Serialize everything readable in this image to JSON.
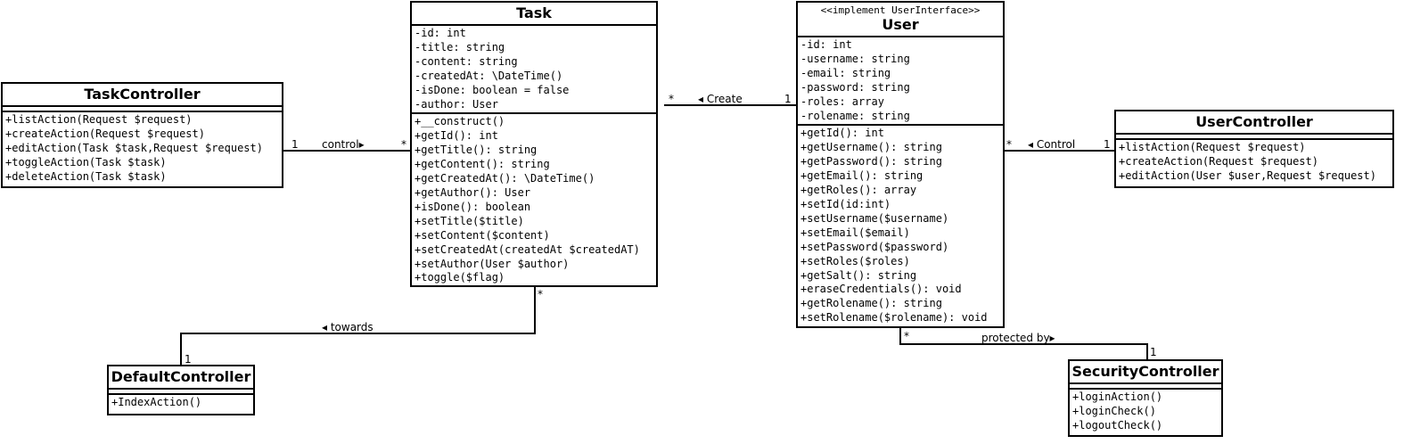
{
  "classes": {
    "task": {
      "name": "Task",
      "attributes": [
        "-id: int",
        "-title: string",
        "-content: string",
        "-createdAt: \\DateTime()",
        "-isDone: boolean = false",
        "-author: User"
      ],
      "methods": [
        "+__construct()",
        "+getId(): int",
        "+getTitle(): string",
        "+getContent(): string",
        "+getCreatedAt(): \\DateTime()",
        "+getAuthor(): User",
        "+isDone(): boolean",
        "+setTitle($title)",
        "+setContent($content)",
        "+setCreatedAt(createdAt $createdAT)",
        "+setAuthor(User $author)",
        "+toggle($flag)"
      ]
    },
    "task_controller": {
      "name": "TaskController",
      "methods": [
        "+listAction(Request $request)",
        "+createAction(Request $request)",
        "+editAction(Task $task,Request $request)",
        "+toggleAction(Task $task)",
        "+deleteAction(Task $task)"
      ]
    },
    "user": {
      "stereotype": "<<implement UserInterface>>",
      "name": "User",
      "attributes": [
        "-id: int",
        "-username: string",
        "-email: string",
        "-password: string",
        "-roles: array",
        "-rolename: string"
      ],
      "methods": [
        "+getId(): int",
        "+getUsername(): string",
        "+getPassword(): string",
        "+getEmail(): string",
        "+getRoles(): array",
        "+setId(id:int)",
        "+setUsername($username)",
        "+setEmail($email)",
        "+setPassword($password)",
        "+setRoles($roles)",
        "+getSalt(): string",
        "+eraseCredentials(): void",
        "+getRolename(): string",
        "+setRolename($rolename): void"
      ]
    },
    "user_controller": {
      "name": "UserController",
      "methods": [
        "+listAction(Request $request)",
        "+createAction(Request $request)",
        "+editAction(User $user,Request $request)"
      ]
    },
    "default_controller": {
      "name": "DefaultController",
      "methods": [
        "+IndexAction()"
      ]
    },
    "security_controller": {
      "name": "SecurityController",
      "methods": [
        "+loginAction()",
        "+loginCheck()",
        "+logoutCheck()"
      ]
    }
  },
  "associations": {
    "control": {
      "label": "control▸",
      "mult_from": "1",
      "mult_to": "*"
    },
    "create": {
      "label": "◂ Create",
      "mult_from": "*",
      "mult_to": "1"
    },
    "user_control": {
      "label": "◂ Control",
      "mult_from": "*",
      "mult_to": "1"
    },
    "towards": {
      "label": "◂ towards",
      "mult_from": "*",
      "mult_to": "1"
    },
    "protected_by": {
      "label": "protected by▸",
      "mult_from": "*",
      "mult_to": "1"
    }
  },
  "colors": {
    "line": "#000000",
    "background": "#ffffff"
  }
}
